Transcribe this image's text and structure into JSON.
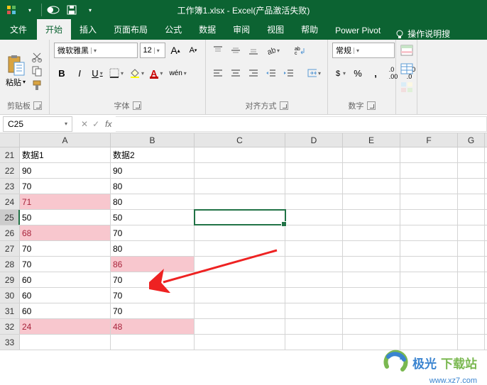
{
  "title": "工作簿1.xlsx - Excel(产品激活失败)",
  "tabs": {
    "file": "文件",
    "home": "开始",
    "insert": "插入",
    "layout": "页面布局",
    "formulas": "公式",
    "data": "数据",
    "review": "审阅",
    "view": "视图",
    "help": "帮助",
    "powerpivot": "Power Pivot",
    "tellme": "操作说明搜"
  },
  "ribbon": {
    "paste": "粘贴",
    "clipboard": "剪贴板",
    "font_name": "微软雅黑",
    "font_size": "12",
    "font_label": "字体",
    "align_label": "对齐方式",
    "number_format": "常规",
    "number_label": "数字",
    "bold": "B",
    "italic": "I",
    "underline": "U",
    "increase_A": "A",
    "decrease_A": "A",
    "wen": "wén"
  },
  "namebox": "C25",
  "fx": "fx",
  "columns": [
    "A",
    "B",
    "C",
    "D",
    "E",
    "F",
    "G"
  ],
  "rows": [
    {
      "n": "21",
      "a": "数据1",
      "b": "数据2"
    },
    {
      "n": "22",
      "a": "90",
      "b": "90"
    },
    {
      "n": "23",
      "a": "70",
      "b": "80"
    },
    {
      "n": "24",
      "a": "71",
      "b": "80",
      "hla": true
    },
    {
      "n": "25",
      "a": "50",
      "b": "50",
      "sel": true
    },
    {
      "n": "26",
      "a": "68",
      "b": "70",
      "hla": true
    },
    {
      "n": "27",
      "a": "70",
      "b": "80"
    },
    {
      "n": "28",
      "a": "70",
      "b": "86",
      "hlb": true
    },
    {
      "n": "29",
      "a": "60",
      "b": "70"
    },
    {
      "n": "30",
      "a": "60",
      "b": "70"
    },
    {
      "n": "31",
      "a": "60",
      "b": "70"
    },
    {
      "n": "32",
      "a": "24",
      "b": "48",
      "hla": true,
      "hlb": true
    },
    {
      "n": "33",
      "a": "",
      "b": ""
    }
  ],
  "watermark": {
    "brand1": "极光",
    "brand2": "下载站",
    "url": "www.xz7.com"
  }
}
